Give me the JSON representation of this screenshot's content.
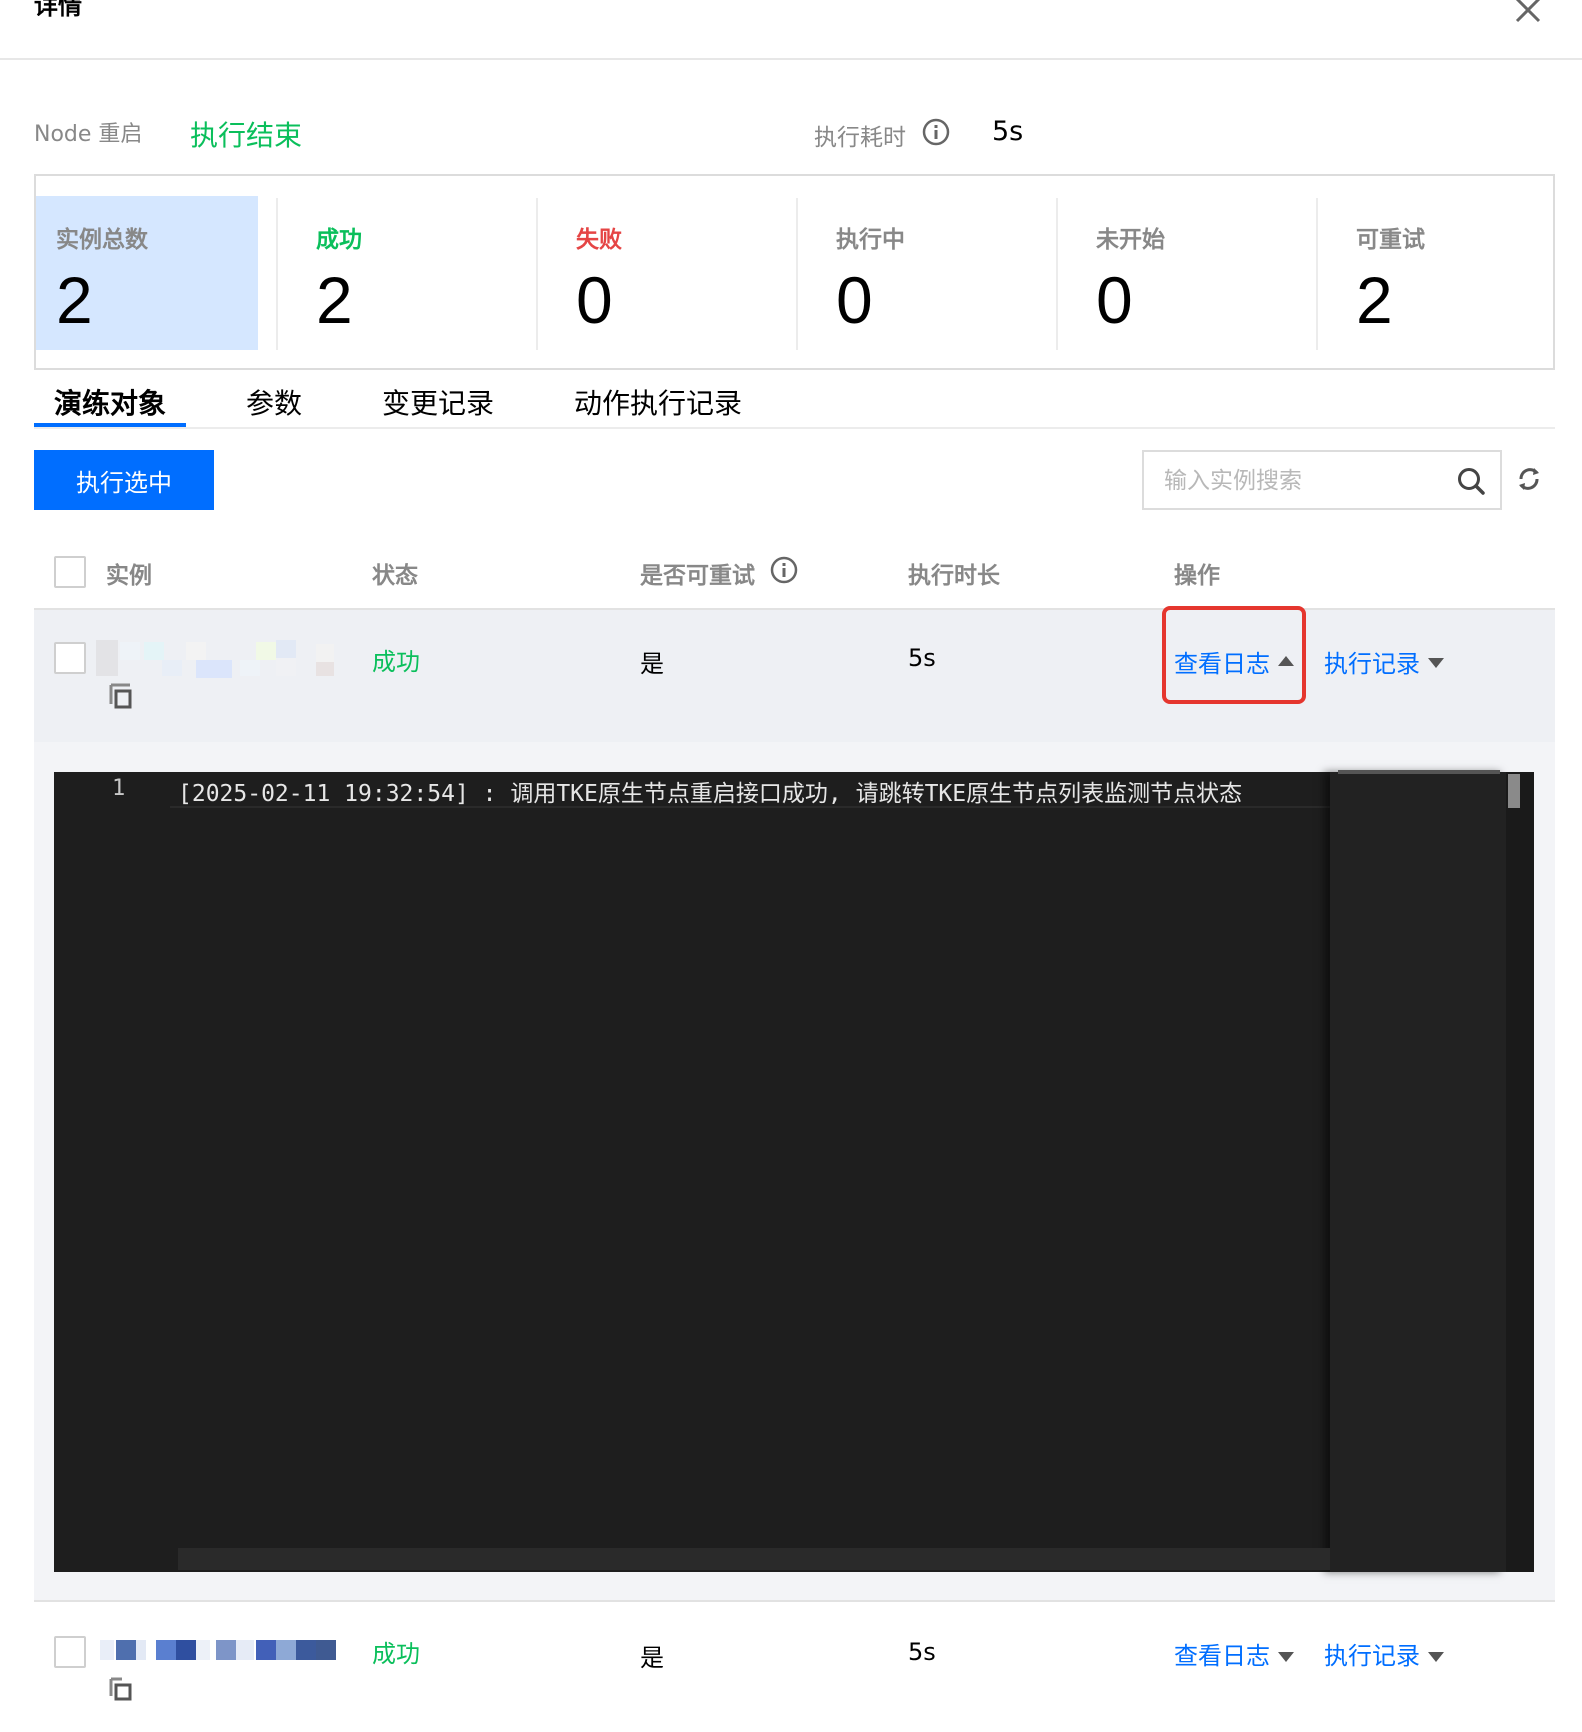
{
  "dialog": {
    "title": "详情"
  },
  "summary": {
    "task_label": "Node 重启",
    "status": "执行结束",
    "duration_label": "执行耗时",
    "duration_value": "5s"
  },
  "stats": [
    {
      "label": "实例总数",
      "value": "2",
      "color": "#888888",
      "active": true
    },
    {
      "label": "成功",
      "value": "2",
      "color": "#0abf5b"
    },
    {
      "label": "失败",
      "value": "0",
      "color": "#e54545"
    },
    {
      "label": "执行中",
      "value": "0",
      "color": "#888888"
    },
    {
      "label": "未开始",
      "value": "0",
      "color": "#888888"
    },
    {
      "label": "可重试",
      "value": "2",
      "color": "#888888"
    }
  ],
  "tabs": [
    {
      "label": "演练对象",
      "active": true
    },
    {
      "label": "参数"
    },
    {
      "label": "变更记录"
    },
    {
      "label": "动作执行记录"
    }
  ],
  "toolbar": {
    "run_selected": "执行选中",
    "search_placeholder": "输入实例搜索"
  },
  "table": {
    "headers": [
      "实例",
      "状态",
      "是否可重试",
      "执行时长",
      "操作"
    ],
    "rows": [
      {
        "status": "成功",
        "retryable": "是",
        "duration": "5s",
        "log_link": "查看日志",
        "record_link": "执行记录",
        "expanded": true
      },
      {
        "status": "成功",
        "retryable": "是",
        "duration": "5s",
        "log_link": "查看日志",
        "record_link": "执行记录",
        "expanded": false
      }
    ]
  },
  "log": {
    "line_number": "1",
    "content": "[2025-02-11 19:32:54] : 调用TKE原生节点重启接口成功, 请跳转TKE原生节点列表监测节点状态"
  },
  "colors": {
    "primary": "#006eff",
    "success": "#0abf5b",
    "error": "#e54545",
    "highlight_box": "#e5362e"
  }
}
